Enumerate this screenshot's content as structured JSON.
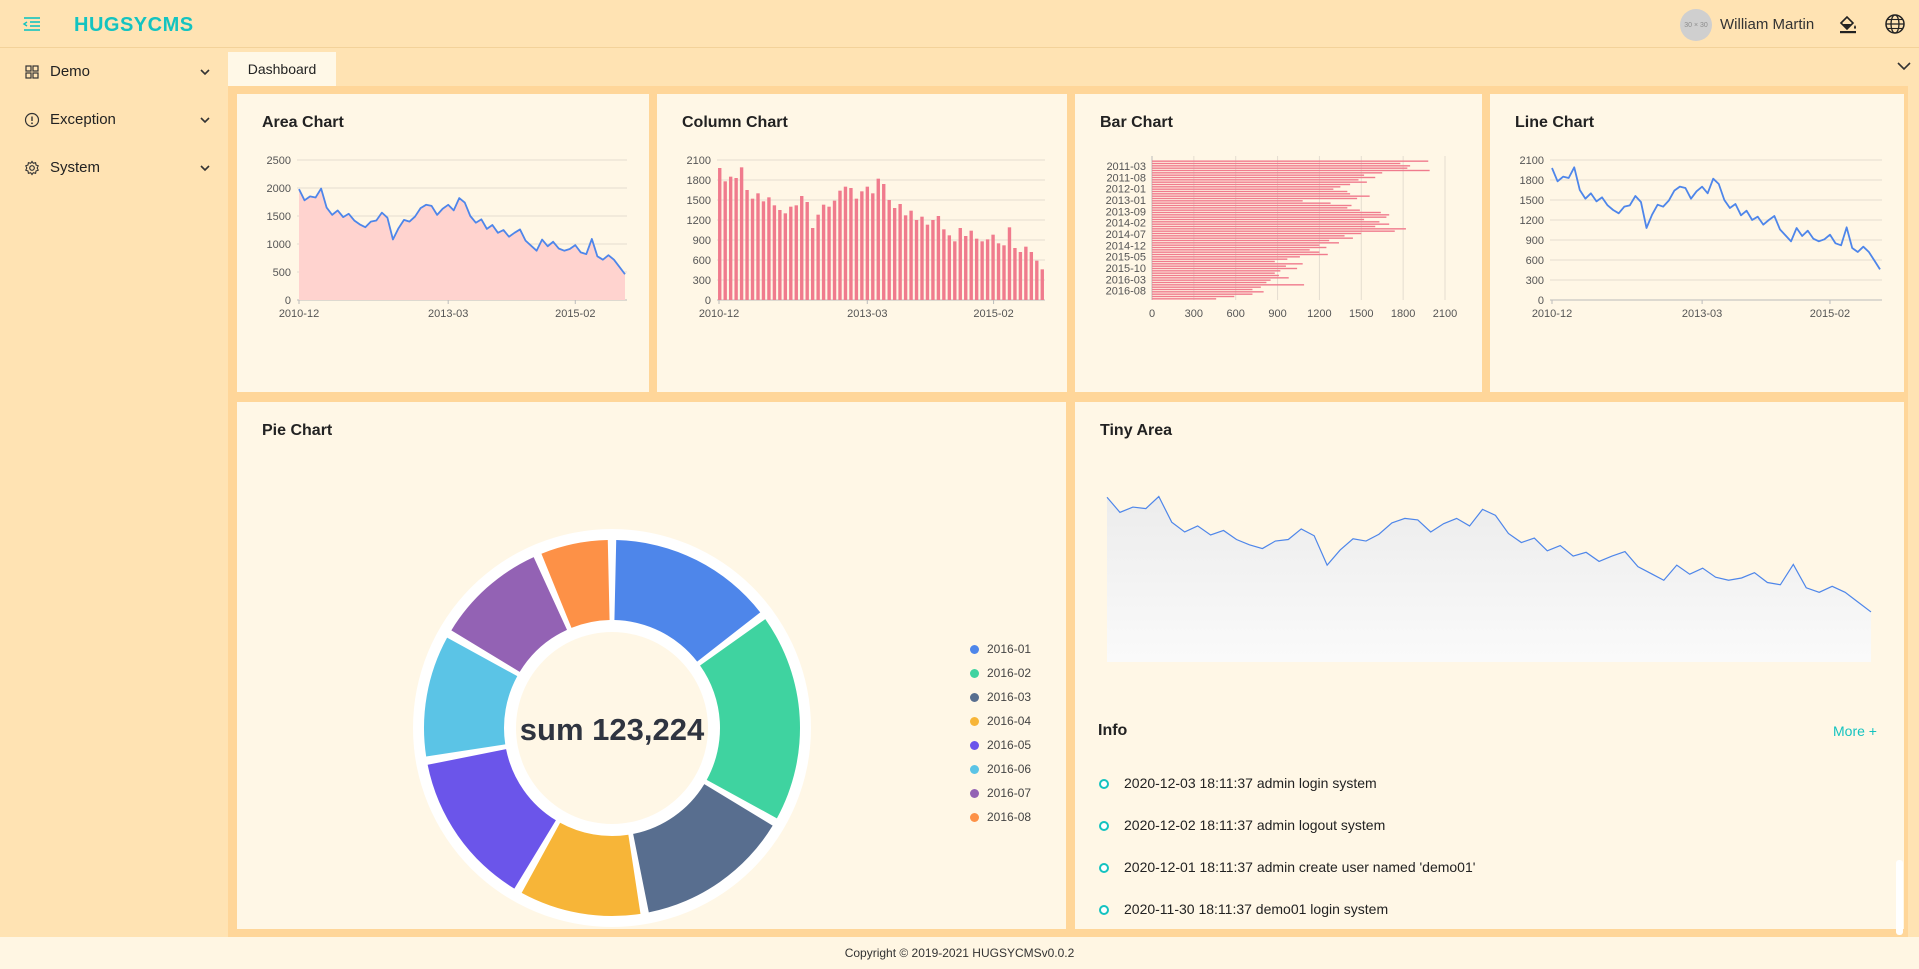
{
  "header": {
    "brand": "HUGSYCMS",
    "avatar_text": "30 × 30",
    "username": "William Martin",
    "accent": "#14c3c0"
  },
  "sidebar": {
    "items": [
      {
        "label": "Demo",
        "icon": "dashboard-grid-icon"
      },
      {
        "label": "Exception",
        "icon": "exclamation-circle-icon"
      },
      {
        "label": "System",
        "icon": "gear-icon"
      }
    ]
  },
  "tabs": [
    {
      "label": "Dashboard",
      "active": true
    }
  ],
  "cards": {
    "area": "Area Chart",
    "column": "Column Chart",
    "bar": "Bar Chart",
    "line": "Line Chart",
    "pie": "Pie Chart",
    "tiny": "Tiny Area",
    "info": "Info"
  },
  "info": {
    "more": "More +",
    "items": [
      "2020-12-03 18:11:37 admin login system",
      "2020-12-02 18:11:37 admin logout system",
      "2020-12-01 18:11:37 admin create user named 'demo01'",
      "2020-11-30 18:11:37 demo01 login system"
    ]
  },
  "pie_center": "sum 123,224",
  "footer": "Copyright © 2019-2021 HUGSYCMSv0.0.2",
  "chart_data": [
    {
      "type": "area",
      "title": "Area Chart",
      "x_ticks": [
        "2010-12",
        "2013-03",
        "2015-02"
      ],
      "y_ticks": [
        0,
        500,
        1000,
        1500,
        2000,
        2500
      ],
      "ylim": [
        0,
        2500
      ],
      "x_start": "2010-12",
      "x_interval": "month",
      "values": [
        1980,
        1780,
        1850,
        1830,
        1990,
        1650,
        1520,
        1600,
        1480,
        1540,
        1420,
        1350,
        1300,
        1400,
        1420,
        1560,
        1470,
        1080,
        1280,
        1430,
        1400,
        1490,
        1640,
        1700,
        1680,
        1520,
        1630,
        1700,
        1600,
        1820,
        1740,
        1500,
        1380,
        1440,
        1270,
        1340,
        1200,
        1250,
        1130,
        1200,
        1260,
        1060,
        970,
        880,
        1080,
        960,
        1040,
        920,
        880,
        910,
        980,
        850,
        820,
        1090,
        780,
        720,
        800,
        720,
        590,
        460
      ],
      "color": "#ffd3cf",
      "line_color": "#4e86ea"
    },
    {
      "type": "bar",
      "title": "Column Chart",
      "x_ticks": [
        "2010-12",
        "2013-03",
        "2015-02"
      ],
      "y_ticks": [
        0,
        300,
        600,
        900,
        1200,
        1500,
        1800,
        2100
      ],
      "ylim": [
        0,
        2100
      ],
      "x_start": "2010-12",
      "x_interval": "month",
      "values": [
        1980,
        1780,
        1850,
        1830,
        1990,
        1650,
        1520,
        1600,
        1480,
        1540,
        1420,
        1350,
        1300,
        1400,
        1420,
        1560,
        1470,
        1080,
        1280,
        1430,
        1400,
        1490,
        1640,
        1700,
        1680,
        1520,
        1630,
        1700,
        1600,
        1820,
        1740,
        1500,
        1380,
        1440,
        1270,
        1340,
        1200,
        1250,
        1130,
        1200,
        1260,
        1060,
        970,
        880,
        1080,
        960,
        1040,
        920,
        880,
        910,
        980,
        850,
        820,
        1090,
        780,
        720,
        800,
        720,
        590,
        460
      ],
      "color": "#f07b8d"
    },
    {
      "type": "bar",
      "orientation": "horizontal",
      "title": "Bar Chart",
      "y_ticks": [
        "2011-03",
        "2011-08",
        "2012-01",
        "2013-01",
        "2013-09",
        "2014-02",
        "2014-07",
        "2014-12",
        "2015-05",
        "2015-10",
        "2016-03",
        "2016-08"
      ],
      "x_ticks": [
        0,
        300,
        600,
        900,
        1200,
        1500,
        1800,
        2100
      ],
      "xlim": [
        0,
        2100
      ],
      "values": [
        1980,
        1780,
        1850,
        1830,
        1990,
        1650,
        1520,
        1600,
        1480,
        1540,
        1420,
        1350,
        1300,
        1400,
        1420,
        1560,
        1470,
        1080,
        1280,
        1430,
        1400,
        1490,
        1640,
        1700,
        1680,
        1520,
        1630,
        1700,
        1600,
        1820,
        1740,
        1500,
        1380,
        1440,
        1270,
        1340,
        1200,
        1250,
        1130,
        1200,
        1260,
        1060,
        970,
        880,
        1080,
        960,
        1040,
        920,
        880,
        910,
        980,
        850,
        820,
        1090,
        780,
        720,
        800,
        720,
        590,
        460
      ],
      "color": "#f07b8d"
    },
    {
      "type": "line",
      "title": "Line Chart",
      "x_ticks": [
        "2010-12",
        "2013-03",
        "2015-02"
      ],
      "y_ticks": [
        0,
        300,
        600,
        900,
        1200,
        1500,
        1800,
        2100
      ],
      "ylim": [
        0,
        2100
      ],
      "x_start": "2010-12",
      "x_interval": "month",
      "values": [
        1980,
        1780,
        1850,
        1830,
        1990,
        1650,
        1520,
        1600,
        1480,
        1540,
        1420,
        1350,
        1300,
        1400,
        1420,
        1560,
        1470,
        1080,
        1280,
        1430,
        1400,
        1490,
        1640,
        1700,
        1680,
        1520,
        1630,
        1700,
        1600,
        1820,
        1740,
        1500,
        1380,
        1440,
        1270,
        1340,
        1200,
        1250,
        1130,
        1200,
        1260,
        1060,
        970,
        880,
        1080,
        960,
        1040,
        920,
        880,
        910,
        980,
        850,
        820,
        1090,
        780,
        720,
        800,
        720,
        590,
        460
      ],
      "color": "#4e86ea"
    },
    {
      "type": "pie",
      "title": "Pie Chart",
      "donut": true,
      "center_text": "sum 123,224",
      "categories": [
        "2016-01",
        "2016-02",
        "2016-03",
        "2016-04",
        "2016-05",
        "2016-06",
        "2016-07",
        "2016-08"
      ],
      "values": [
        16,
        20,
        15,
        12,
        15,
        12,
        11,
        7
      ],
      "colors": [
        "#4e86ea",
        "#3fd3a0",
        "#586e8f",
        "#f7b538",
        "#6b55ea",
        "#5bc4e6",
        "#9362b4",
        "#fd9147"
      ],
      "legend": "right"
    },
    {
      "type": "area",
      "title": "Tiny Area",
      "axes": false,
      "values": [
        1980,
        1780,
        1850,
        1830,
        1990,
        1650,
        1520,
        1600,
        1480,
        1540,
        1420,
        1350,
        1300,
        1400,
        1420,
        1560,
        1470,
        1080,
        1280,
        1430,
        1400,
        1490,
        1640,
        1700,
        1680,
        1520,
        1630,
        1700,
        1600,
        1820,
        1740,
        1500,
        1380,
        1440,
        1270,
        1340,
        1200,
        1250,
        1130,
        1200,
        1260,
        1060,
        970,
        880,
        1080,
        960,
        1040,
        920,
        880,
        910,
        980,
        850,
        820,
        1090,
        780,
        720,
        800,
        720,
        590,
        460
      ],
      "line_color": "#4e86ea",
      "fill_color": "#f3f3f3"
    }
  ]
}
